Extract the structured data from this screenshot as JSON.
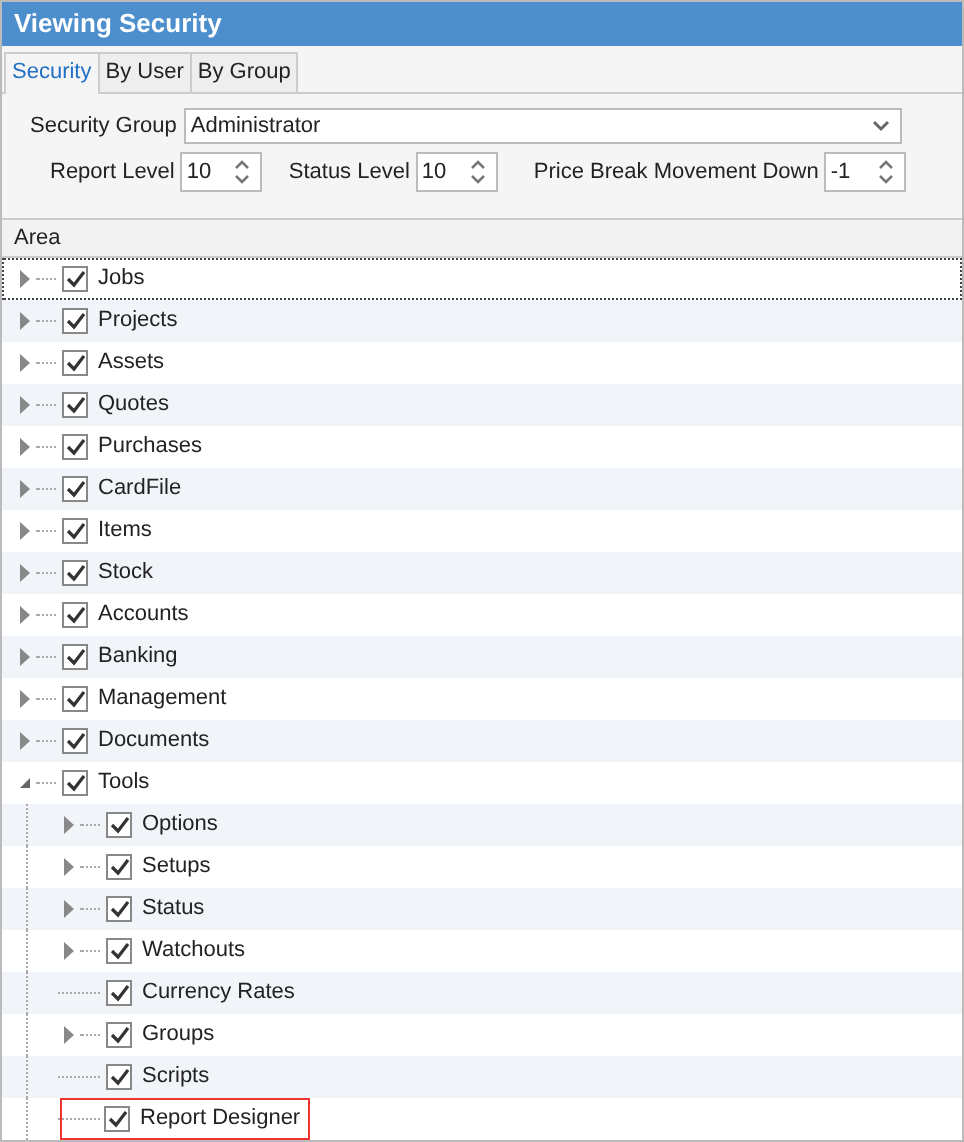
{
  "window": {
    "title": "Viewing Security"
  },
  "tabs": [
    {
      "label": "Security",
      "selected": true
    },
    {
      "label": "By User",
      "selected": false
    },
    {
      "label": "By Group",
      "selected": false
    }
  ],
  "security_group": {
    "label": "Security Group",
    "value": "Administrator"
  },
  "levels": [
    {
      "label": "Report Level",
      "value": "10"
    },
    {
      "label": "Status Level",
      "value": "10"
    },
    {
      "label": "Price Break Movement Down",
      "value": "-1"
    }
  ],
  "tree": {
    "column": "Area",
    "items": [
      {
        "label": "Jobs",
        "checked": true,
        "expandable": true,
        "expanded": false,
        "focused": true
      },
      {
        "label": "Projects",
        "checked": true,
        "expandable": true,
        "expanded": false
      },
      {
        "label": "Assets",
        "checked": true,
        "expandable": true,
        "expanded": false
      },
      {
        "label": "Quotes",
        "checked": true,
        "expandable": true,
        "expanded": false
      },
      {
        "label": "Purchases",
        "checked": true,
        "expandable": true,
        "expanded": false
      },
      {
        "label": "CardFile",
        "checked": true,
        "expandable": true,
        "expanded": false
      },
      {
        "label": "Items",
        "checked": true,
        "expandable": true,
        "expanded": false
      },
      {
        "label": "Stock",
        "checked": true,
        "expandable": true,
        "expanded": false
      },
      {
        "label": "Accounts",
        "checked": true,
        "expandable": true,
        "expanded": false
      },
      {
        "label": "Banking",
        "checked": true,
        "expandable": true,
        "expanded": false
      },
      {
        "label": "Management",
        "checked": true,
        "expandable": true,
        "expanded": false
      },
      {
        "label": "Documents",
        "checked": true,
        "expandable": true,
        "expanded": false
      },
      {
        "label": "Tools",
        "checked": true,
        "expandable": true,
        "expanded": true,
        "children": [
          {
            "label": "Options",
            "checked": true,
            "expandable": true,
            "expanded": false
          },
          {
            "label": "Setups",
            "checked": true,
            "expandable": true,
            "expanded": false
          },
          {
            "label": "Status",
            "checked": true,
            "expandable": true,
            "expanded": false
          },
          {
            "label": "Watchouts",
            "checked": true,
            "expandable": true,
            "expanded": false
          },
          {
            "label": "Currency Rates",
            "checked": true,
            "expandable": false
          },
          {
            "label": "Groups",
            "checked": true,
            "expandable": true,
            "expanded": false
          },
          {
            "label": "Scripts",
            "checked": true,
            "expandable": false
          },
          {
            "label": "Report Designer",
            "checked": true,
            "expandable": false,
            "highlighted": true
          }
        ]
      }
    ]
  }
}
